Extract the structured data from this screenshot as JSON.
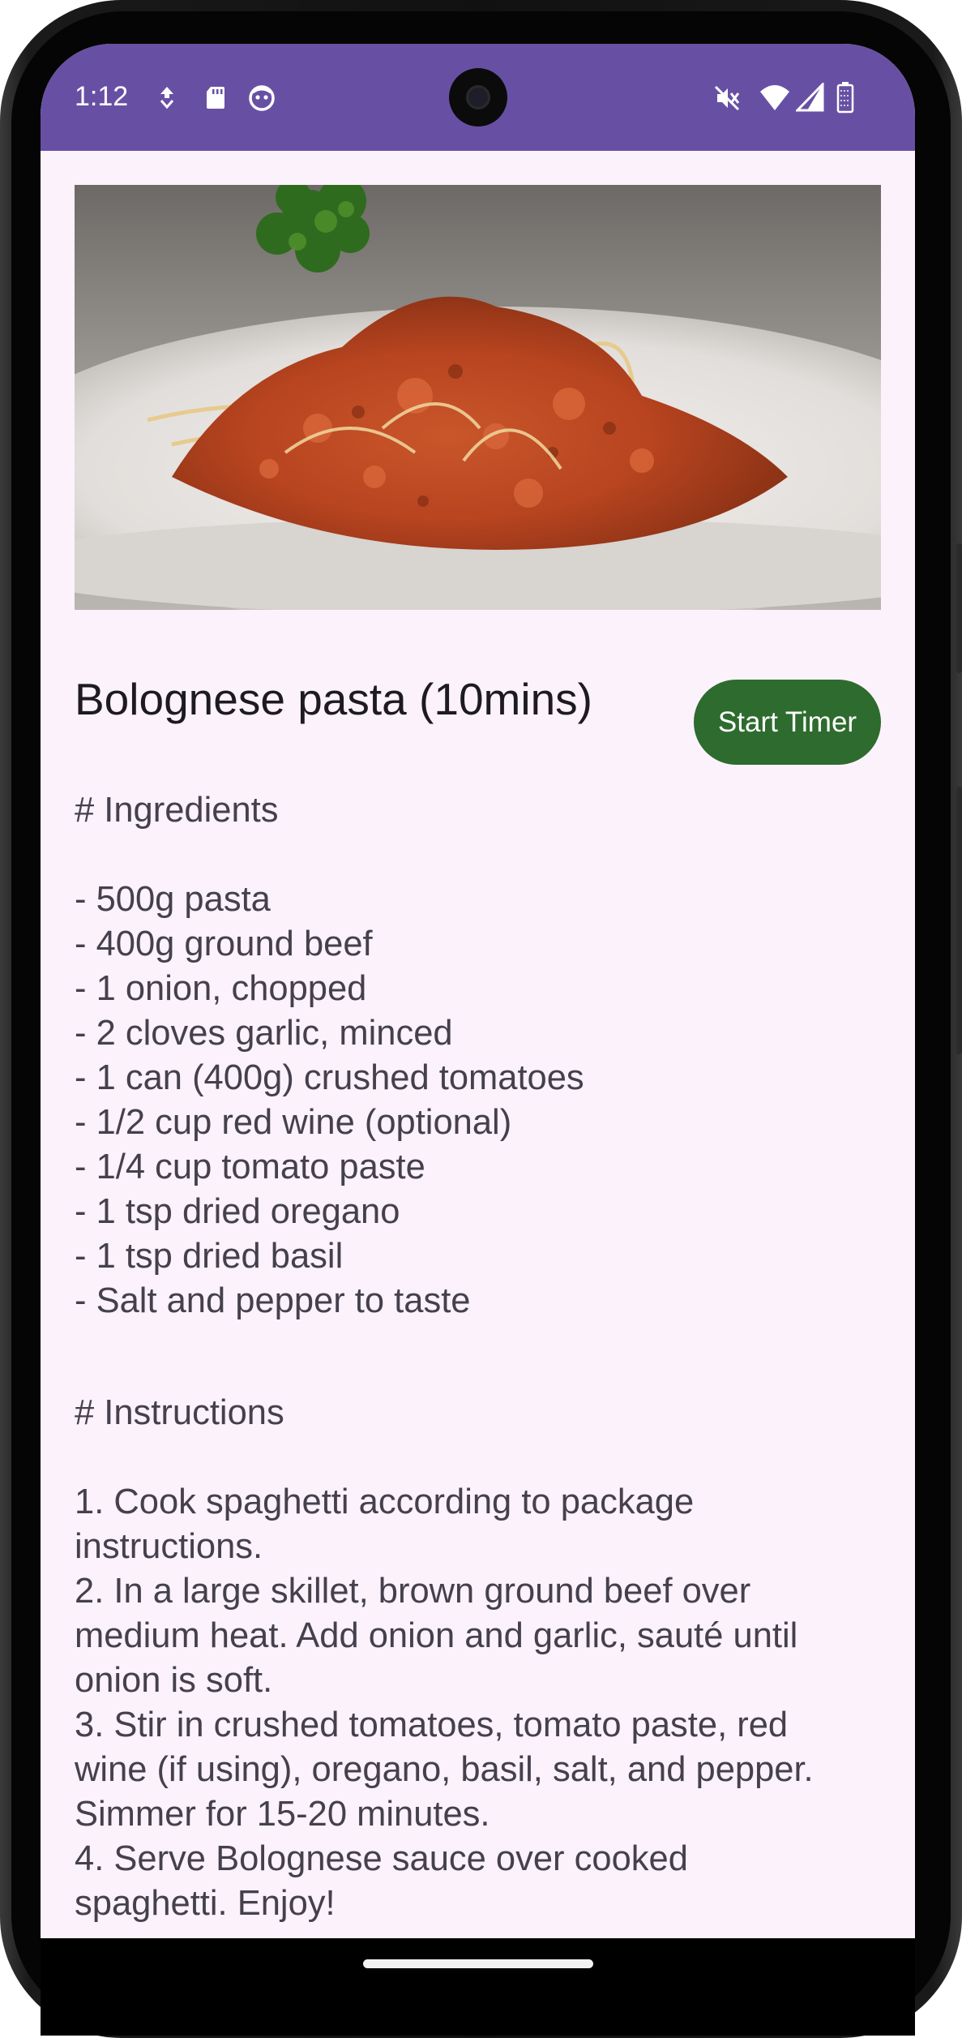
{
  "status_bar": {
    "time": "1:12",
    "left_icons": [
      "data-saver-icon",
      "sd-card-icon",
      "android-debug-icon"
    ],
    "right_icons": [
      "mute-icon",
      "wifi-icon",
      "cell-signal-icon",
      "battery-icon"
    ],
    "color": "#6750a4"
  },
  "recipe": {
    "image_subject": "Bolognese pasta on a white plate with parsley garnish",
    "title": "Bolognese pasta (10mins)",
    "start_timer_label": "Start Timer",
    "ingredients_heading": "# Ingredients",
    "ingredients": [
      "- 500g pasta",
      "- 400g ground beef",
      "- 1 onion, chopped",
      "- 2 cloves garlic, minced",
      "- 1 can (400g) crushed tomatoes",
      "- 1/2 cup red wine (optional)",
      "- 1/4 cup tomato paste",
      "- 1 tsp dried oregano",
      "- 1 tsp dried basil",
      "- Salt and pepper to taste"
    ],
    "instructions_heading": "# Instructions",
    "instruction_lines": [
      "1. Cook spaghetti according to package",
      "instructions.",
      "2. In a large skillet, brown ground beef over",
      "medium heat. Add onion and garlic, sauté until",
      "onion is soft.",
      "3. Stir in crushed tomatoes, tomato paste, red",
      "wine (if using), oregano, basil, salt, and pepper.",
      "Simmer for 15-20 minutes.",
      "4. Serve Bolognese sauce over cooked",
      "spaghetti. Enjoy!"
    ]
  },
  "colors": {
    "background": "#fbf2fb",
    "button": "#2e6b2e",
    "text": "#45414c"
  }
}
